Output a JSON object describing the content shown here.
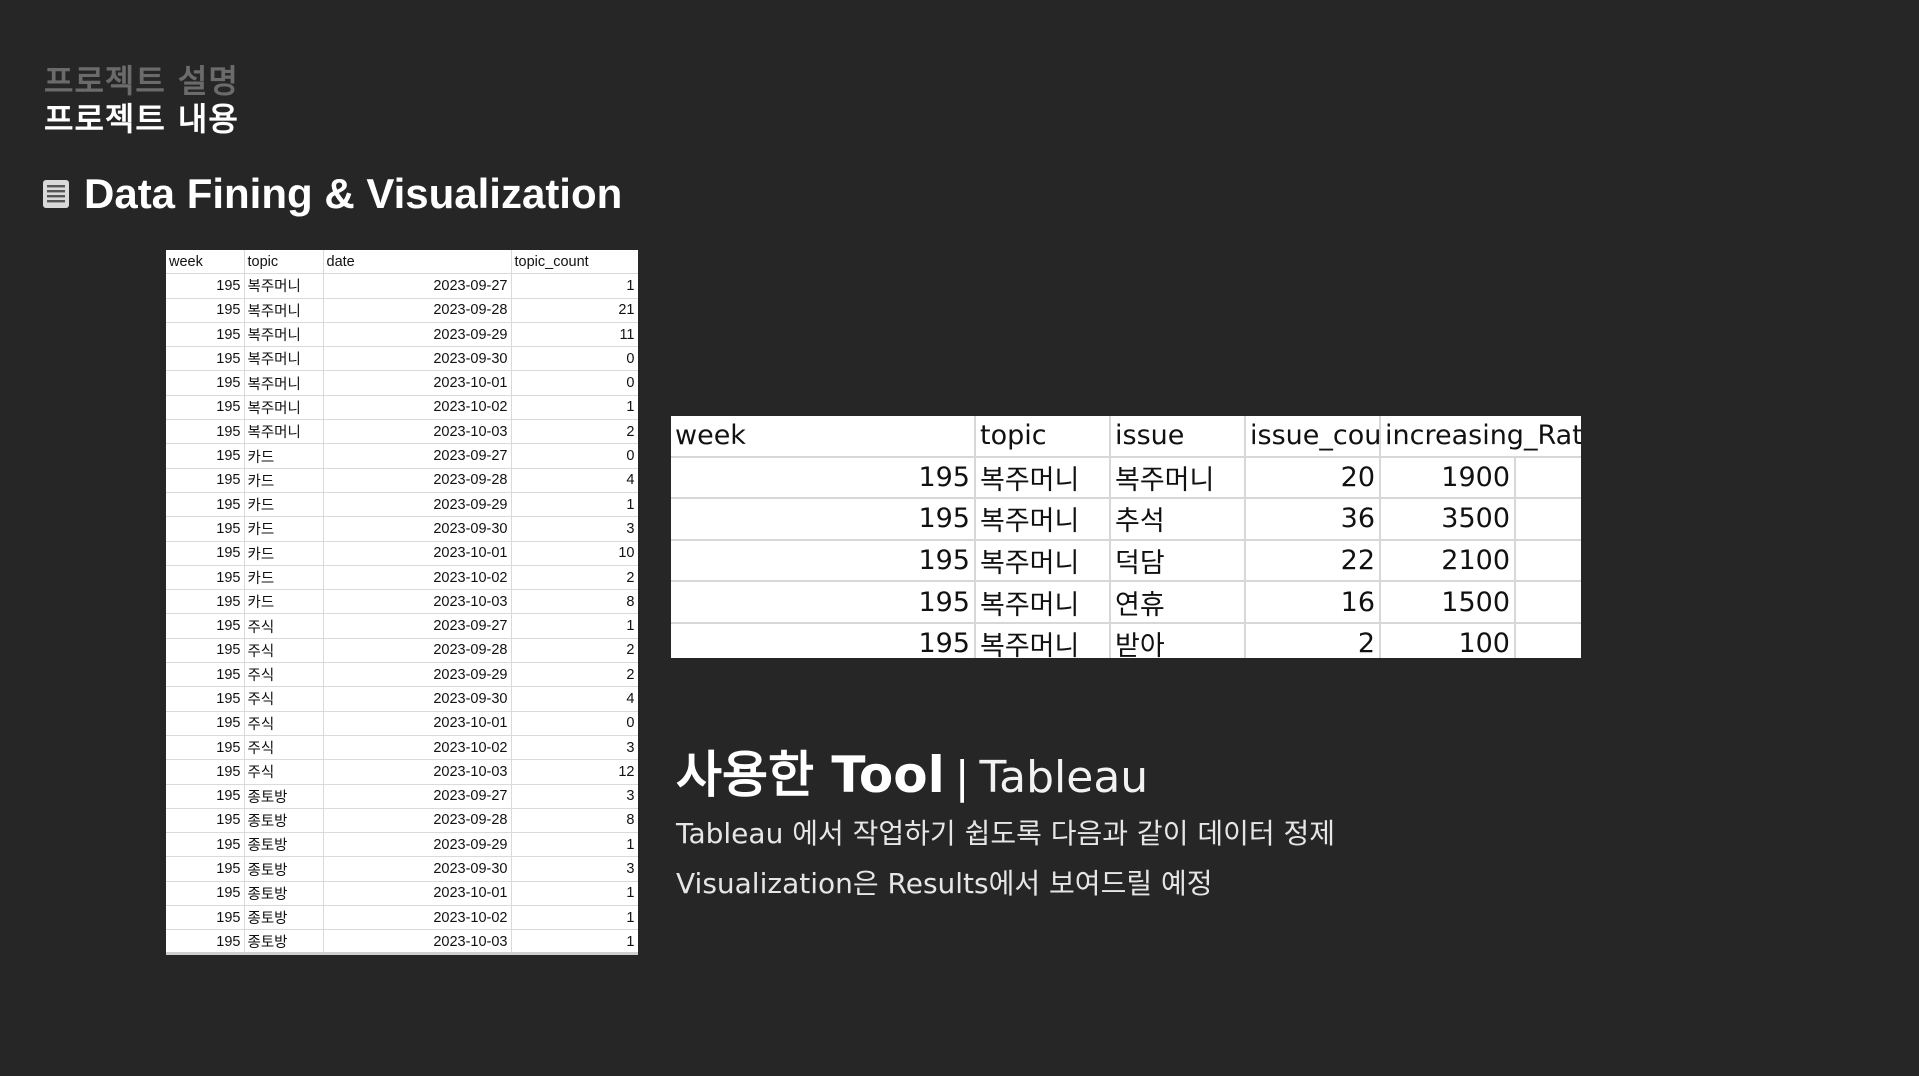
{
  "nav": {
    "prev_label": "프로젝트 설명",
    "current_label": "프로젝트 내용"
  },
  "section": {
    "icon": "document-icon",
    "title": "Data Fining & Visualization"
  },
  "left_table": {
    "headers": [
      "week",
      "topic",
      "date",
      "topic_count"
    ],
    "rows": [
      [
        "195",
        "복주머니",
        "2023-09-27",
        "1"
      ],
      [
        "195",
        "복주머니",
        "2023-09-28",
        "21"
      ],
      [
        "195",
        "복주머니",
        "2023-09-29",
        "11"
      ],
      [
        "195",
        "복주머니",
        "2023-09-30",
        "0"
      ],
      [
        "195",
        "복주머니",
        "2023-10-01",
        "0"
      ],
      [
        "195",
        "복주머니",
        "2023-10-02",
        "1"
      ],
      [
        "195",
        "복주머니",
        "2023-10-03",
        "2"
      ],
      [
        "195",
        "카드",
        "2023-09-27",
        "0"
      ],
      [
        "195",
        "카드",
        "2023-09-28",
        "4"
      ],
      [
        "195",
        "카드",
        "2023-09-29",
        "1"
      ],
      [
        "195",
        "카드",
        "2023-09-30",
        "3"
      ],
      [
        "195",
        "카드",
        "2023-10-01",
        "10"
      ],
      [
        "195",
        "카드",
        "2023-10-02",
        "2"
      ],
      [
        "195",
        "카드",
        "2023-10-03",
        "8"
      ],
      [
        "195",
        "주식",
        "2023-09-27",
        "1"
      ],
      [
        "195",
        "주식",
        "2023-09-28",
        "2"
      ],
      [
        "195",
        "주식",
        "2023-09-29",
        "2"
      ],
      [
        "195",
        "주식",
        "2023-09-30",
        "4"
      ],
      [
        "195",
        "주식",
        "2023-10-01",
        "0"
      ],
      [
        "195",
        "주식",
        "2023-10-02",
        "3"
      ],
      [
        "195",
        "주식",
        "2023-10-03",
        "12"
      ],
      [
        "195",
        "종토방",
        "2023-09-27",
        "3"
      ],
      [
        "195",
        "종토방",
        "2023-09-28",
        "8"
      ],
      [
        "195",
        "종토방",
        "2023-09-29",
        "1"
      ],
      [
        "195",
        "종토방",
        "2023-09-30",
        "3"
      ],
      [
        "195",
        "종토방",
        "2023-10-01",
        "1"
      ],
      [
        "195",
        "종토방",
        "2023-10-02",
        "1"
      ],
      [
        "195",
        "종토방",
        "2023-10-03",
        "1"
      ]
    ]
  },
  "right_table": {
    "headers": [
      "week",
      "topic",
      "issue",
      "issue_cour",
      "increasing_Rate"
    ],
    "rows": [
      [
        "195",
        "복주머니",
        "복주머니",
        "20",
        "1900"
      ],
      [
        "195",
        "복주머니",
        "추석",
        "36",
        "3500"
      ],
      [
        "195",
        "복주머니",
        "덕담",
        "22",
        "2100"
      ],
      [
        "195",
        "복주머니",
        "연휴",
        "16",
        "1500"
      ],
      [
        "195",
        "복주머니",
        "받아",
        "2",
        "100"
      ]
    ]
  },
  "tool": {
    "label": "사용한 Tool",
    "separator": "|",
    "name": "Tableau"
  },
  "description": {
    "line1": "Tableau 에서 작업하기 쉽도록 다음과 같이 데이터 정제",
    "line2": "Visualization은 Results에서 보여드릴 예정"
  }
}
